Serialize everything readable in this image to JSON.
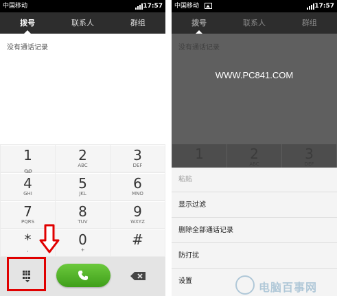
{
  "status": {
    "carrier": "中国移动",
    "time": "17:57"
  },
  "tabs": [
    "拨号",
    "联系人",
    "群组"
  ],
  "empty_text": "没有通话记录",
  "keys": [
    {
      "digit": "1",
      "letters": ""
    },
    {
      "digit": "2",
      "letters": "ABC"
    },
    {
      "digit": "3",
      "letters": "DEF"
    },
    {
      "digit": "4",
      "letters": "GHI"
    },
    {
      "digit": "5",
      "letters": "JKL"
    },
    {
      "digit": "6",
      "letters": "MNO"
    },
    {
      "digit": "7",
      "letters": "PQRS"
    },
    {
      "digit": "8",
      "letters": "TUV"
    },
    {
      "digit": "9",
      "letters": "WXYZ"
    },
    {
      "digit": "*",
      "letters": ","
    },
    {
      "digit": "0",
      "letters": "+"
    },
    {
      "digit": "#",
      "letters": ""
    }
  ],
  "watermark": "WWW.PC841.COM",
  "menu": [
    "粘贴",
    "显示过滤",
    "删除全部通话记录",
    "防打扰",
    "设置"
  ],
  "corner_watermark": "电脑百事网",
  "colors": {
    "call_green": "#4aad24",
    "highlight_red": "#e00000",
    "tabbar": "#2d2d2d"
  }
}
